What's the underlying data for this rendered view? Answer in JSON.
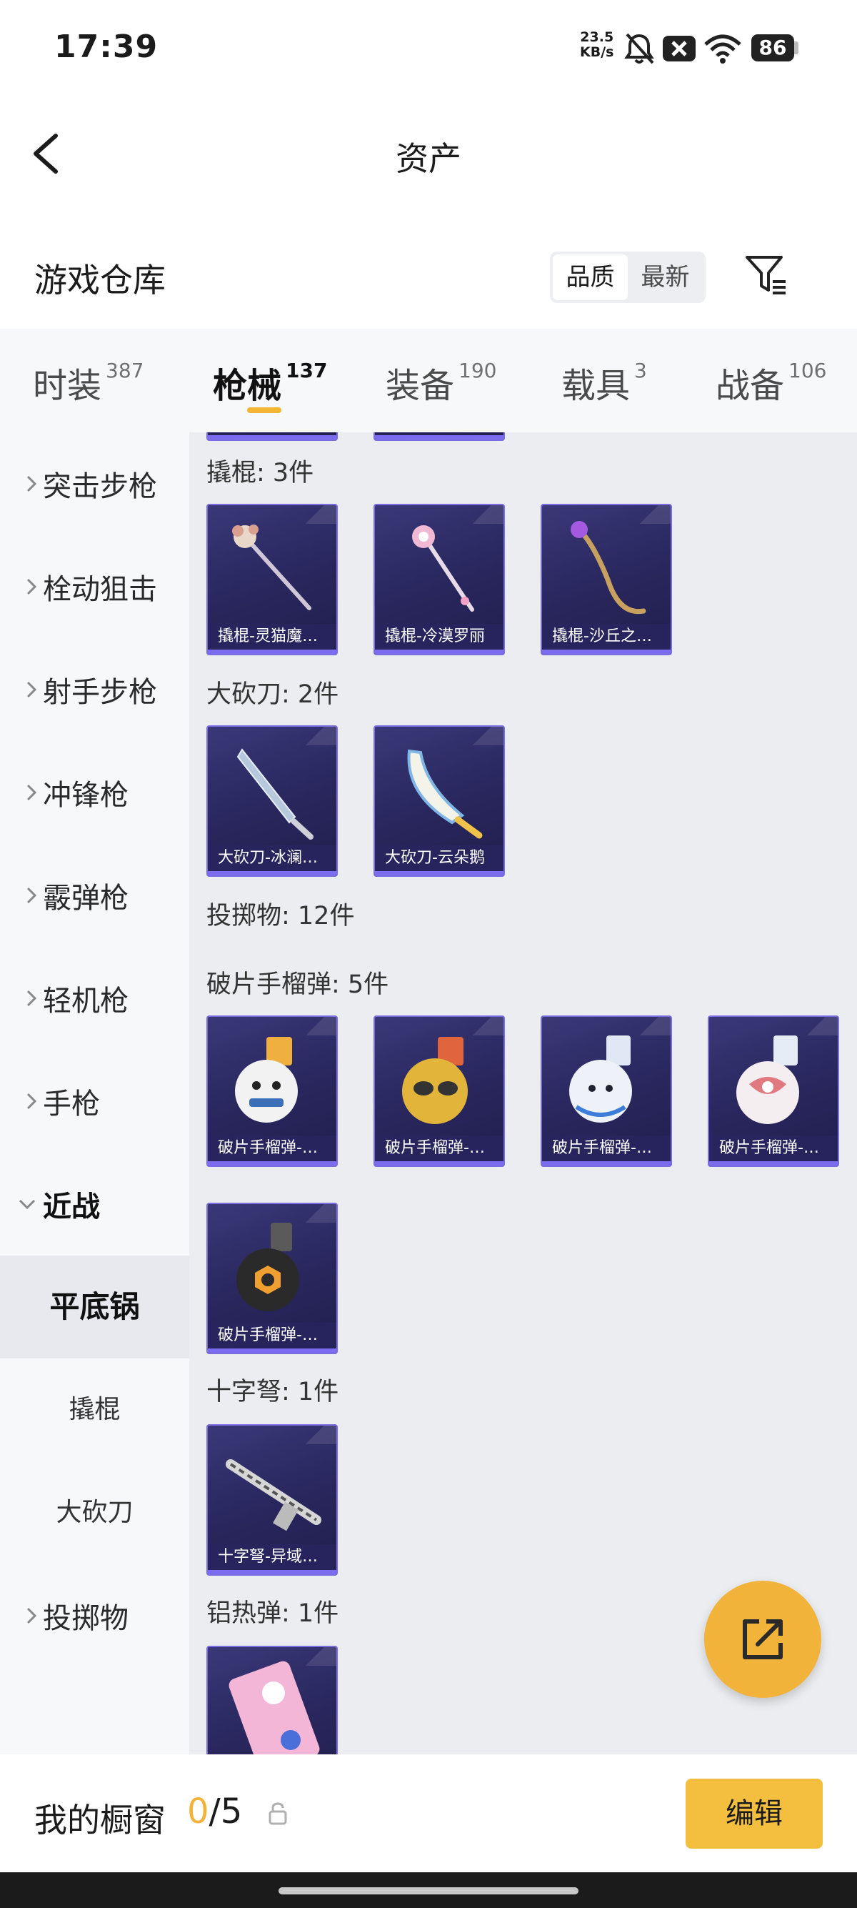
{
  "status_bar": {
    "time": "17:39",
    "net_speed_value": "23.5",
    "net_speed_unit": "KB/s",
    "battery": "86",
    "icons": [
      "bell-off-icon",
      "sim-off-icon",
      "wifi-icon",
      "battery-icon"
    ]
  },
  "header": {
    "title": "资产",
    "back_icon": "chevron-left-icon"
  },
  "warehouse": {
    "title": "游戏仓库",
    "sort_options": [
      "品质",
      "最新"
    ],
    "active_sort": "品质",
    "filter_icon": "filter-icon"
  },
  "tabs": [
    {
      "label": "时装",
      "count": "387"
    },
    {
      "label": "枪械",
      "count": "137",
      "active": true
    },
    {
      "label": "装备",
      "count": "190"
    },
    {
      "label": "载具",
      "count": "3"
    },
    {
      "label": "战备",
      "count": "106"
    }
  ],
  "sidebar": {
    "categories": [
      "突击步枪",
      "栓动狙击",
      "射手步枪",
      "冲锋枪",
      "霰弹枪",
      "轻机枪",
      "手枪",
      "近战"
    ],
    "expanded": "近战",
    "subcategories": [
      "平底锅",
      "撬棍",
      "大砍刀"
    ],
    "selected_sub": "平底锅",
    "after": [
      "投掷物"
    ]
  },
  "sections": [
    {
      "title": "撬棍: 3件",
      "items": [
        "撬棍-灵猫魔…",
        "撬棍-冷漠罗丽",
        "撬棍-沙丘之…"
      ]
    },
    {
      "title": "大砍刀: 2件",
      "items": [
        "大砍刀-冰澜…",
        "大砍刀-云朵鹅"
      ]
    },
    {
      "title": "投掷物: 12件",
      "items": []
    },
    {
      "title": "破片手榴弹: 5件",
      "items": [
        "破片手榴弹-…",
        "破片手榴弹-…",
        "破片手榴弹-…",
        "破片手榴弹-…",
        "破片手榴弹-…"
      ]
    },
    {
      "title": "十字弩: 1件",
      "items": [
        "十字弩-异域…"
      ]
    },
    {
      "title": "铝热弹: 1件",
      "items": []
    }
  ],
  "fab_icon": "share-external-icon",
  "showcase": {
    "label": "我的橱窗",
    "current": "0",
    "separator": "/",
    "max": "5",
    "lock_icon": "lock-icon",
    "edit_label": "编辑"
  },
  "colors": {
    "accent": "#F4BE3E",
    "card_bg": "#2B2962",
    "card_border": "#7A6DE0",
    "content_bg": "#EBEDF0",
    "sidebar_bg": "#F7F8FA"
  }
}
